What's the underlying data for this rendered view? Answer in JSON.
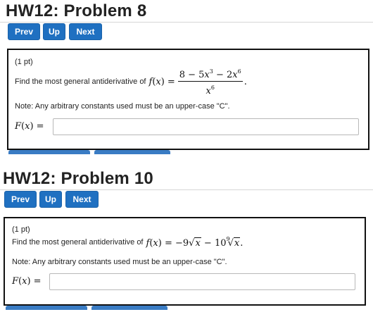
{
  "problem8": {
    "title": "HW12: Problem 8",
    "nav": {
      "prev": "Prev",
      "up": "Up",
      "next": "Next"
    },
    "points": "(1 pt)",
    "prompt": "Find the most general antiderivative of",
    "note": "Note: Any arbitrary constants used must be an upper-case \"C\".",
    "answer_label": "F(x) =",
    "answer_value": ""
  },
  "problem10": {
    "title": "HW12: Problem 10",
    "nav": {
      "prev": "Prev",
      "up": "Up",
      "next": "Next"
    },
    "points": "(1 pt)",
    "prompt": "Find the most general antiderivative of",
    "note": "Note: Any arbitrary constants used must be an upper-case \"C\".",
    "answer_label": "F(x) =",
    "answer_value": ""
  },
  "colors": {
    "button": "#1f70c1",
    "box_border": "#111111",
    "rule": "#d6d6d6"
  }
}
